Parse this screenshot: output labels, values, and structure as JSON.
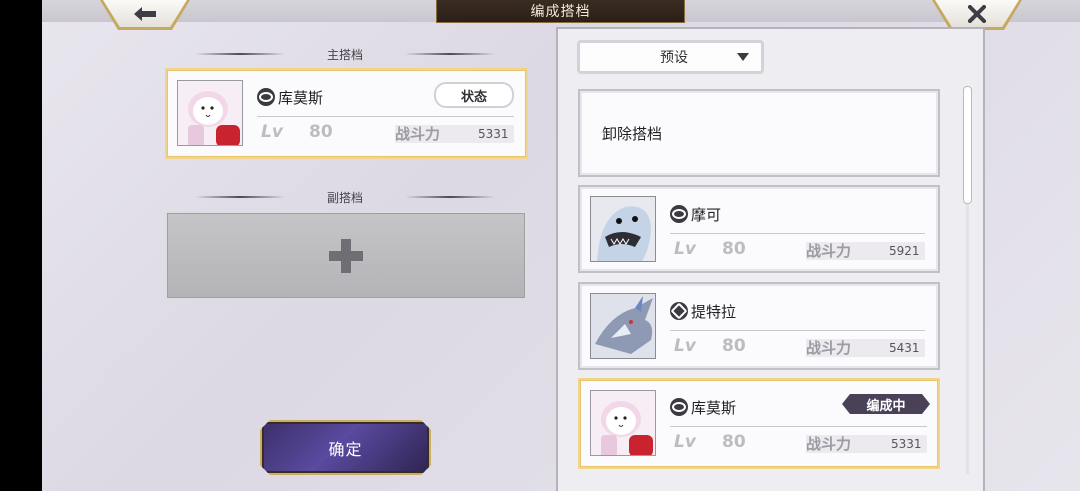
{
  "header": {
    "title": "编成搭档",
    "back_icon": "arrow-left-icon",
    "close_icon": "close-icon"
  },
  "main_partner": {
    "section_label": "主搭档",
    "name": "库莫斯",
    "status_button": "状态",
    "lv_label": "Lv",
    "level": "80",
    "power_label": "战斗力",
    "power": "5331"
  },
  "sub_partner": {
    "section_label": "副搭档",
    "add_icon": "plus-icon"
  },
  "confirm_button": "确定",
  "right_panel": {
    "preset_label": "预设",
    "unequip_label": "卸除搭档",
    "list": [
      {
        "name": "摩可",
        "lv_label": "Lv",
        "level": "80",
        "power_label": "战斗力",
        "power": "5921",
        "selected": false
      },
      {
        "name": "提特拉",
        "lv_label": "Lv",
        "level": "80",
        "power_label": "战斗力",
        "power": "5431",
        "selected": false
      },
      {
        "name": "库莫斯",
        "lv_label": "Lv",
        "level": "80",
        "power_label": "战斗力",
        "power": "5331",
        "selected": true,
        "badge": "编成中"
      }
    ]
  },
  "colors": {
    "accent_gold": "#e7c56f",
    "confirm_purple": "#5a4aa0",
    "badge_dark": "#4a4157"
  }
}
